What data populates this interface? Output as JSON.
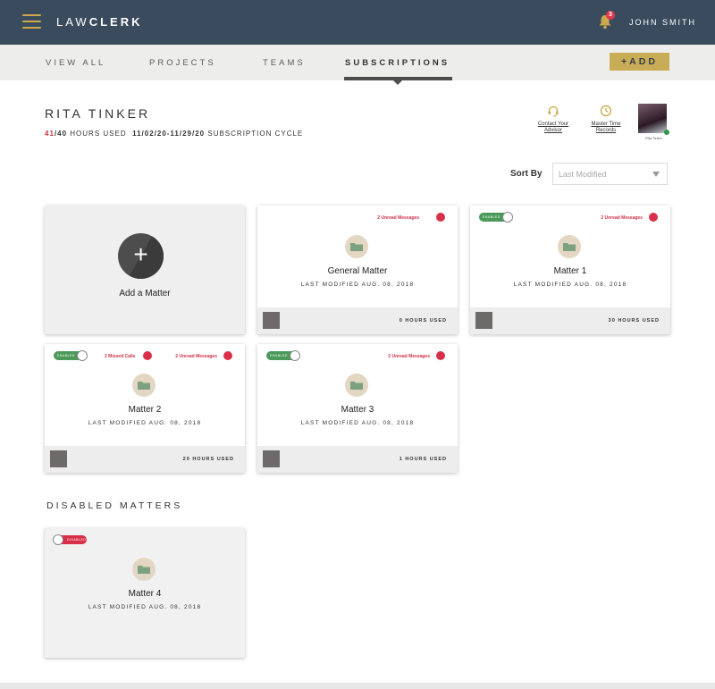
{
  "app": {
    "brand_light": "LAW",
    "brand_bold": "CLERK",
    "user": "JOHN SMITH",
    "notification_count": "3"
  },
  "colors": {
    "topbar": "#3a4b5e",
    "accent": "#c9ad56",
    "alert": "#d9304a",
    "enabled": "#4b9a5a"
  },
  "nav": {
    "items": [
      "VIEW ALL",
      "PROJECTS",
      "TEAMS",
      "SUBSCRIPTIONS"
    ],
    "active": "SUBSCRIPTIONS",
    "add_label": "+ADD"
  },
  "header": {
    "client_name": "RITA TINKER",
    "hours_used": "41",
    "hours_total": "/40",
    "hours_label": "HOURS USED",
    "cycle_dates": "11/02/20-11/29/20",
    "cycle_label": "SUBSCRIPTION CYCLE",
    "contact_advisor": "Contact Your Advisor",
    "master_time": "Master Time Records",
    "avatar_name": "Rita Tinker"
  },
  "sort": {
    "label": "Sort By",
    "value": "Last Modified"
  },
  "add_matter": {
    "label": "Add a Matter",
    "icon": "plus-icon"
  },
  "matters": [
    {
      "title": "General Matter",
      "modified": "LAST MODIFIED AUG. 08, 2018",
      "unread": "2 Unread Messages",
      "missed": "",
      "toggle": "",
      "hours": "0 HOURS USED"
    },
    {
      "title": "Matter 1",
      "modified": "LAST MODIFIED AUG. 08, 2018",
      "unread": "2 Unread Messages",
      "missed": "",
      "toggle": "ENABLED",
      "hours": "30 HOURS USED"
    },
    {
      "title": "Matter 2",
      "modified": "LAST MODIFIED AUG. 08, 2018",
      "unread": "2 Unread Messages",
      "missed": "2 Missed Calls",
      "toggle": "ENABLED",
      "hours": "20 HOURS USED"
    },
    {
      "title": "Matter 3",
      "modified": "LAST MODIFIED AUG. 08, 2018",
      "unread": "2 Unread Messages",
      "missed": "",
      "toggle": "ENABLED",
      "hours": "1 HOURS USED"
    }
  ],
  "disabled_section": {
    "title": "DISABLED MATTERS",
    "matters": [
      {
        "title": "Matter 4",
        "modified": "LAST MODIFIED AUG. 08, 2018",
        "toggle": "DISABLED"
      }
    ]
  }
}
